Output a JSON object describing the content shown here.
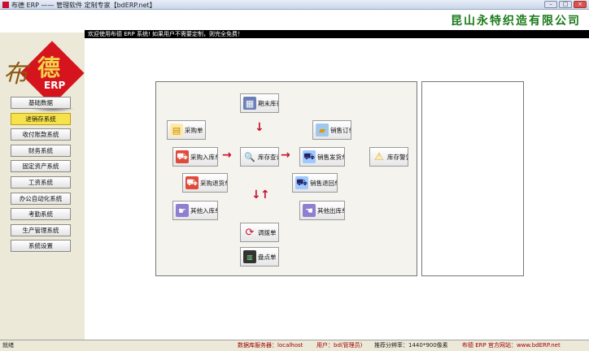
{
  "window": {
    "title": "布德 ERP —— 管理软件 定制专家【bdERP.net】",
    "controls": [
      "–",
      "□",
      "×"
    ]
  },
  "header": {
    "company": "昆山永特织造有限公司",
    "welcome": "欢迎使用布德 ERP 系统! 如果用户不需要定制，则完全免费！"
  },
  "logo": {
    "char_bu": "布",
    "char_de": "德",
    "erp": "ERP"
  },
  "sidebar": {
    "items": [
      {
        "label": "基础数据",
        "active": false
      },
      {
        "label": "进销存系统",
        "active": true
      },
      {
        "label": "收付账款系统",
        "active": false
      },
      {
        "label": "财务系统",
        "active": false
      },
      {
        "label": "固定资产系统",
        "active": false
      },
      {
        "label": "工资系统",
        "active": false
      },
      {
        "label": "办公自动化系统",
        "active": false
      },
      {
        "label": "考勤系统",
        "active": false
      },
      {
        "label": "生产管理系统",
        "active": false
      },
      {
        "label": "系统设置",
        "active": false
      }
    ]
  },
  "flow": {
    "period_end_stock": {
      "label": "期末库存",
      "icon": "calendar-icon"
    },
    "purchase_order": {
      "label": "采购单",
      "icon": "document-icon"
    },
    "sales_order": {
      "label": "销售订单",
      "icon": "folder-icon"
    },
    "purchase_in": {
      "label": "采购入库单",
      "icon": "cart-icon"
    },
    "stock_query": {
      "label": "库存查询",
      "icon": "magnifier-icon"
    },
    "sales_delivery": {
      "label": "销售发货单",
      "icon": "truck-icon"
    },
    "stock_alert": {
      "label": "库存警告",
      "icon": "warning-icon"
    },
    "purchase_return": {
      "label": "采购退货单",
      "icon": "cart-return-icon"
    },
    "sales_return": {
      "label": "销售退回单",
      "icon": "truck-return-icon"
    },
    "other_in": {
      "label": "其他入库单",
      "icon": "hand-in-icon"
    },
    "other_out": {
      "label": "其他出库单",
      "icon": "hand-out-icon"
    },
    "transfer": {
      "label": "调拨单",
      "icon": "cycle-icon"
    },
    "inventory_count": {
      "label": "盘点单",
      "icon": "counter-icon"
    }
  },
  "status": {
    "ready": "就绪",
    "db_server": "数据库服务器：localhost",
    "user": "用户：bd(管理员)",
    "resolution": "推荐分辨率：1440*900像素",
    "website": "布德 ERP 官方网站：www.bdERP.net"
  },
  "colors": {
    "accent_active": "#f6e24a",
    "arrow_red": "#c8102e",
    "company_green": "#1a7a1a",
    "status_red": "#a00000"
  }
}
